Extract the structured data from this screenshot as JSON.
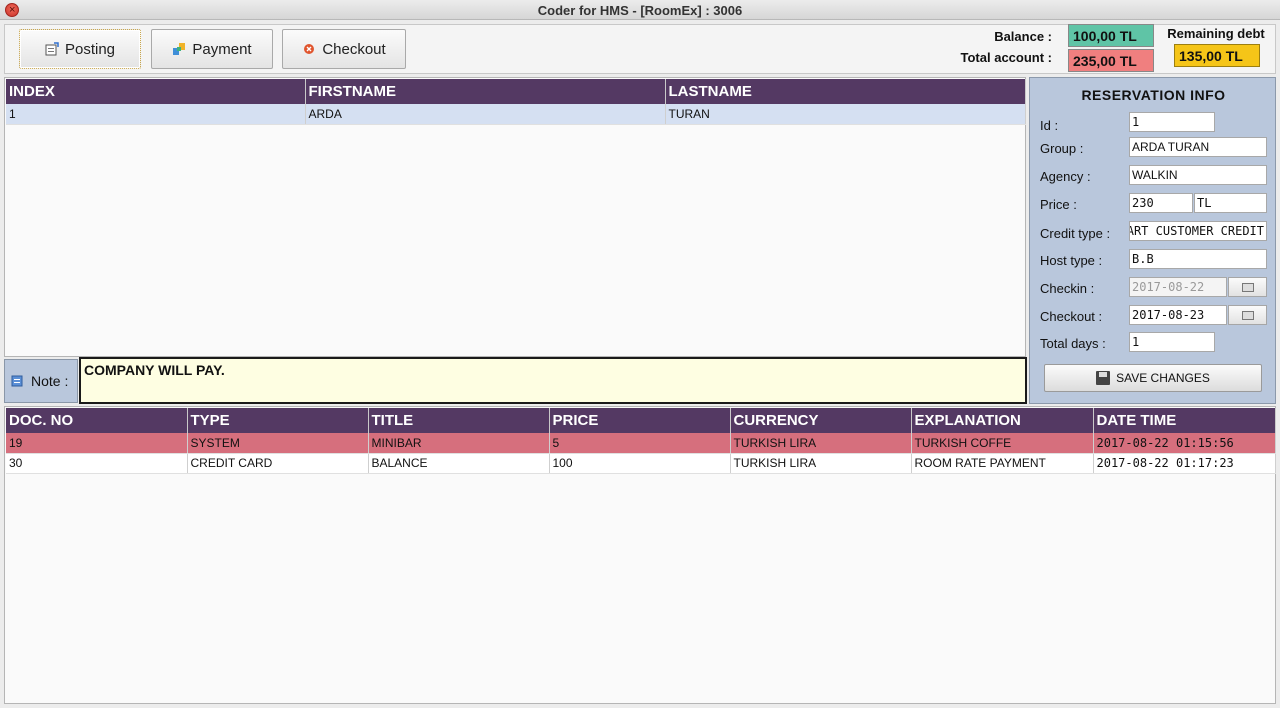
{
  "window": {
    "title": "Coder for HMS - [RoomEx] : 3006"
  },
  "toolbar": {
    "posting_label": "Posting",
    "payment_label": "Payment",
    "checkout_label": "Checkout"
  },
  "summary": {
    "balance_label": "Balance :",
    "balance_value": "100,00 TL",
    "total_label": "Total account :",
    "total_value": "235,00 TL",
    "remaining_label": "Remaining debt",
    "remaining_value": "135,00 TL"
  },
  "guests": {
    "columns": [
      "INDEX",
      "FIRSTNAME",
      "LASTNAME"
    ],
    "rows": [
      {
        "index": "1",
        "firstname": "ARDA",
        "lastname": "TURAN"
      }
    ]
  },
  "note": {
    "label": "Note :",
    "text": "COMPANY WILL PAY."
  },
  "reservation": {
    "title": "RESERVATION INFO",
    "id_label": "Id :",
    "id_value": "1",
    "group_label": "Group :",
    "group_value": "ARDA TURAN",
    "agency_label": "Agency :",
    "agency_value": "WALKIN",
    "price_label": "Price :",
    "price_value": "230",
    "price_currency": "TL",
    "credit_label": "Credit type :",
    "credit_value": "ART CUSTOMER CREDIT",
    "host_label": "Host type :",
    "host_value": "B.B",
    "checkin_label": "Checkin :",
    "checkin_value": "2017-08-22",
    "checkout_label": "Checkout :",
    "checkout_value": "2017-08-23",
    "days_label": "Total days :",
    "days_value": "1",
    "save_label": "SAVE CHANGES"
  },
  "documents": {
    "columns": [
      "DOC. NO",
      "TYPE",
      "TITLE",
      "PRICE",
      "CURRENCY",
      "EXPLANATION",
      "DATE TIME"
    ],
    "rows": [
      {
        "doc_no": "19",
        "type": "SYSTEM",
        "title": "MINIBAR",
        "price": "5",
        "currency": "TURKISH LIRA",
        "explanation": "TURKISH COFFE",
        "datetime": "2017-08-22 01:15:56"
      },
      {
        "doc_no": "30",
        "type": "CREDIT CARD",
        "title": "BALANCE",
        "price": "100",
        "currency": "TURKISH LIRA",
        "explanation": "ROOM RATE PAYMENT",
        "datetime": "2017-08-22 01:17:23"
      }
    ]
  },
  "colors": {
    "header_purple": "#543963",
    "balance_green": "#5fc4a6",
    "total_red": "#f07f7f",
    "remaining_yellow": "#f5c518",
    "system_row": "#d66f7d",
    "selected_row": "#d5e0f2",
    "panel_blue": "#b9c7dc",
    "note_bg": "#fefee2"
  }
}
